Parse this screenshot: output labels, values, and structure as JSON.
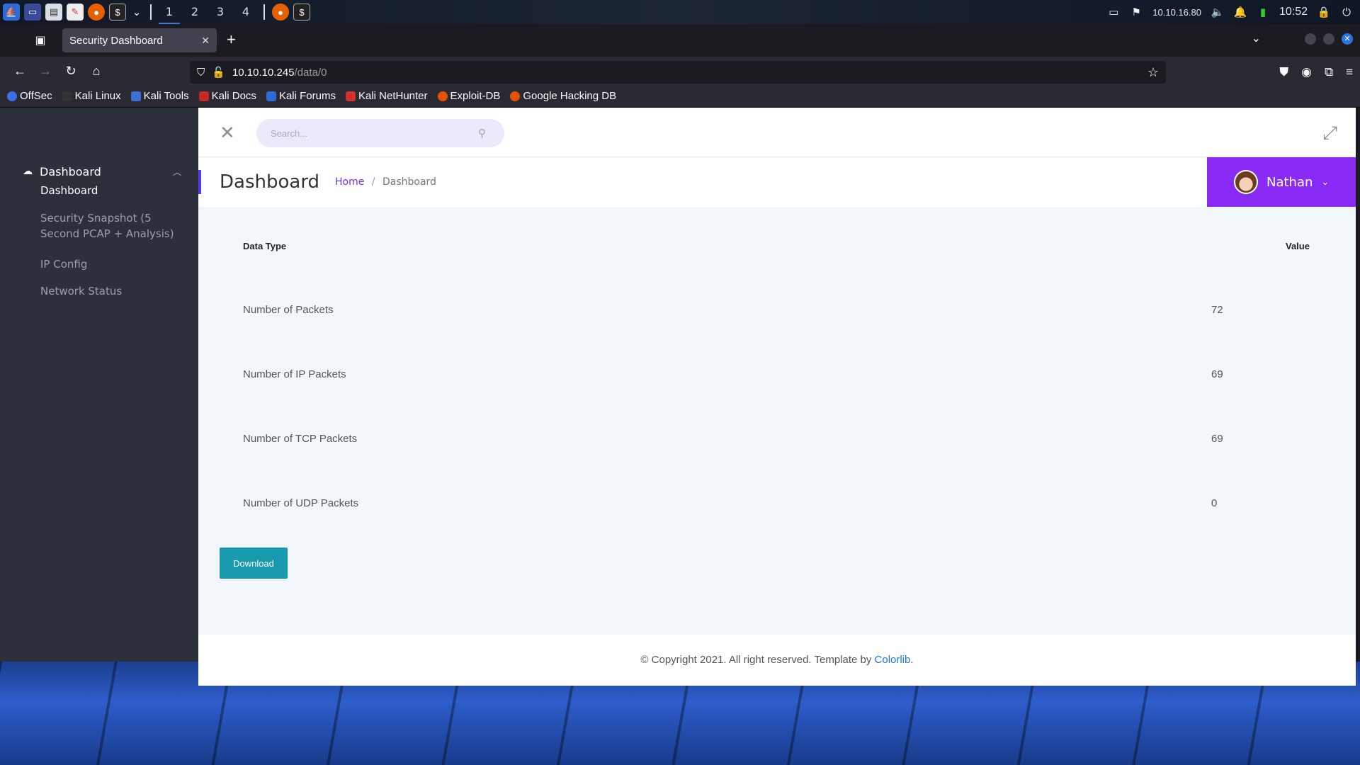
{
  "system_panel": {
    "workspaces": [
      "1",
      "2",
      "3",
      "4"
    ],
    "active_workspace": "1",
    "ip_address": "10.10.16.80",
    "clock": "10:52"
  },
  "browser": {
    "tab_title": "Security Dashboard",
    "url_host": "10.10.10.245",
    "url_path": "/data/0",
    "bookmarks": [
      "OffSec",
      "Kali Linux",
      "Kali Tools",
      "Kali Docs",
      "Kali Forums",
      "Kali NetHunter",
      "Exploit-DB",
      "Google Hacking DB"
    ]
  },
  "sidebar": {
    "group_label": "Dashboard",
    "items": [
      {
        "label": "Dashboard"
      },
      {
        "label": "Security Snapshot (5 Second PCAP + Analysis)"
      },
      {
        "label": "IP Config"
      },
      {
        "label": "Network Status"
      }
    ]
  },
  "topbar": {
    "search_placeholder": "Search..."
  },
  "header": {
    "title": "Dashboard",
    "breadcrumb_home": "Home",
    "breadcrumb_sep": "/",
    "breadcrumb_current": "Dashboard",
    "user_name": "Nathan"
  },
  "table": {
    "col_type": "Data Type",
    "col_value": "Value",
    "rows": [
      {
        "label": "Number of Packets",
        "value": "72"
      },
      {
        "label": "Number of IP Packets",
        "value": "69"
      },
      {
        "label": "Number of TCP Packets",
        "value": "69"
      },
      {
        "label": "Number of UDP Packets",
        "value": "0"
      }
    ]
  },
  "download_label": "Download",
  "footer": {
    "text": "© Copyright 2021. All right reserved. Template by ",
    "link": "Colorlib",
    "suffix": "."
  },
  "colors": {
    "accent_purple": "#8a2bf5",
    "download_teal": "#1899ae",
    "sidebar_bg": "#2b303b"
  }
}
